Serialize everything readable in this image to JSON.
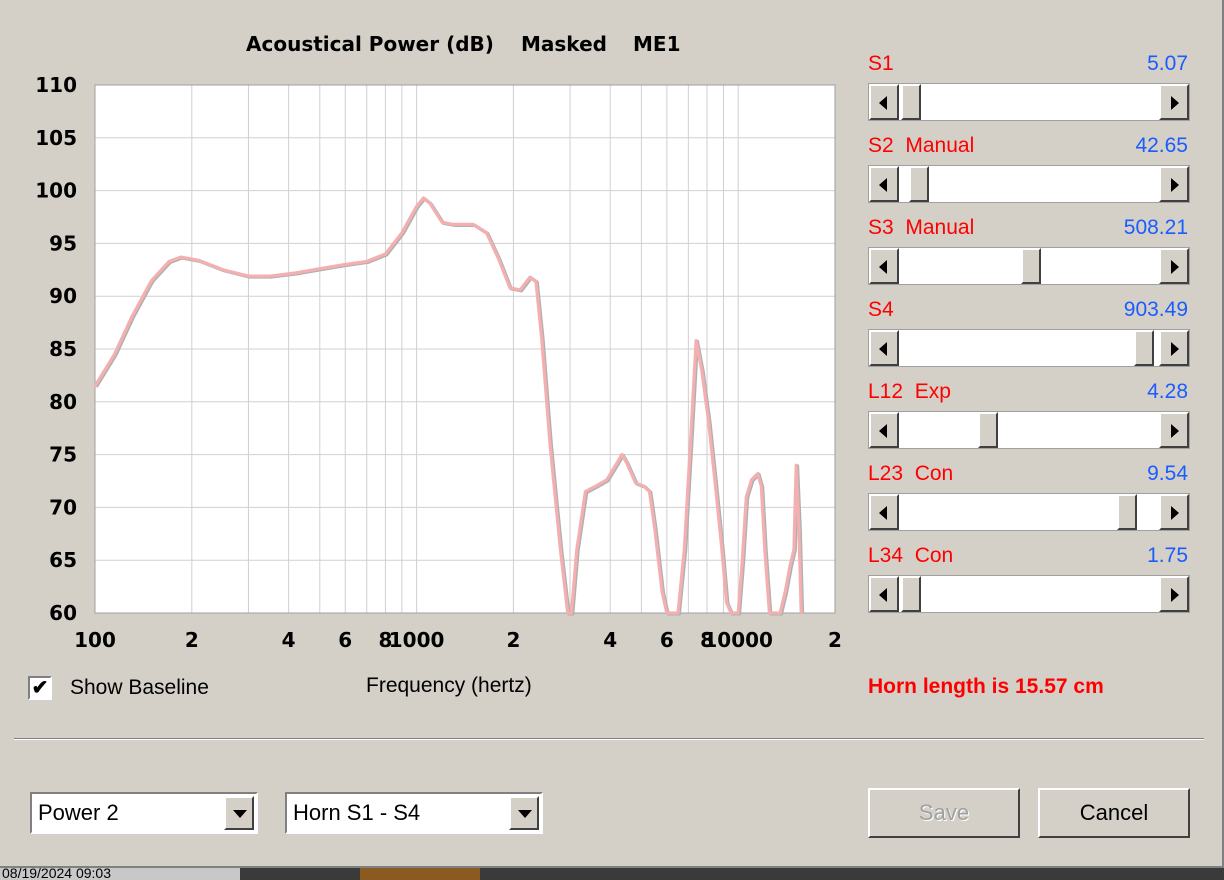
{
  "chart_data": {
    "type": "line",
    "title_parts": [
      "Acoustical Power (dB)",
      "Masked",
      "ME1"
    ],
    "xlabel": "Frequency (hertz)",
    "ylabel": "",
    "xscale": "log",
    "xlim": [
      100,
      20000
    ],
    "ylim": [
      60,
      110
    ],
    "yticks": [
      110,
      105,
      100,
      95,
      90,
      85,
      80,
      75,
      70,
      65,
      60
    ],
    "xticks": [
      {
        "v": 100,
        "label": "100"
      },
      {
        "v": 200,
        "label": "2"
      },
      {
        "v": 400,
        "label": "4"
      },
      {
        "v": 600,
        "label": "6"
      },
      {
        "v": 800,
        "label": "8"
      },
      {
        "v": 1000,
        "label": "1000"
      },
      {
        "v": 2000,
        "label": "2"
      },
      {
        "v": 4000,
        "label": "4"
      },
      {
        "v": 6000,
        "label": "6"
      },
      {
        "v": 8000,
        "label": "8"
      },
      {
        "v": 10000,
        "label": "10000"
      },
      {
        "v": 20000,
        "label": "2"
      }
    ],
    "grid": true,
    "series_color": "#f4b0b0",
    "baseline_color": "#b0b0b0",
    "series": [
      {
        "name": "",
        "points": [
          [
            100,
            81.5
          ],
          [
            115,
            84.5
          ],
          [
            130,
            88
          ],
          [
            150,
            91.5
          ],
          [
            170,
            93.3
          ],
          [
            185,
            93.7
          ],
          [
            210,
            93.4
          ],
          [
            250,
            92.5
          ],
          [
            300,
            91.9
          ],
          [
            350,
            91.9
          ],
          [
            420,
            92.2
          ],
          [
            500,
            92.6
          ],
          [
            600,
            93
          ],
          [
            700,
            93.3
          ],
          [
            800,
            94
          ],
          [
            900,
            96
          ],
          [
            1000,
            98.5
          ],
          [
            1050,
            99.3
          ],
          [
            1100,
            98.8
          ],
          [
            1200,
            97
          ],
          [
            1300,
            96.8
          ],
          [
            1500,
            96.8
          ],
          [
            1650,
            96
          ],
          [
            1800,
            93.5
          ],
          [
            1950,
            90.8
          ],
          [
            2100,
            90.6
          ],
          [
            2250,
            91.8
          ],
          [
            2350,
            91.4
          ],
          [
            2450,
            86
          ],
          [
            2600,
            76
          ],
          [
            2800,
            66
          ],
          [
            2950,
            60
          ],
          [
            3030,
            60
          ],
          [
            3150,
            66
          ],
          [
            3350,
            71.5
          ],
          [
            3600,
            72
          ],
          [
            3900,
            72.6
          ],
          [
            4200,
            74.2
          ],
          [
            4350,
            75
          ],
          [
            4500,
            74.2
          ],
          [
            4800,
            72.3
          ],
          [
            5100,
            72
          ],
          [
            5300,
            71.5
          ],
          [
            5500,
            68
          ],
          [
            5800,
            62
          ],
          [
            6000,
            60
          ],
          [
            6500,
            60
          ],
          [
            6800,
            66
          ],
          [
            7100,
            76
          ],
          [
            7400,
            85.8
          ],
          [
            7700,
            83
          ],
          [
            8100,
            78
          ],
          [
            8500,
            72
          ],
          [
            8900,
            66
          ],
          [
            9200,
            61
          ],
          [
            9500,
            60
          ],
          [
            10000,
            60
          ],
          [
            10300,
            65
          ],
          [
            10600,
            71
          ],
          [
            11000,
            72.6
          ],
          [
            11500,
            73.2
          ],
          [
            11800,
            72
          ],
          [
            12100,
            66
          ],
          [
            12500,
            60
          ],
          [
            13500,
            60
          ],
          [
            14000,
            62
          ],
          [
            14500,
            64.5
          ],
          [
            14900,
            66
          ],
          [
            15150,
            74
          ],
          [
            15450,
            68
          ],
          [
            15700,
            60
          ]
        ]
      }
    ]
  },
  "sliders": [
    {
      "label": "S1",
      "value": "5.07",
      "level": 0.01
    },
    {
      "label": "S2  Manual",
      "value": "42.65",
      "level": 0.04
    },
    {
      "label": "S3  Manual",
      "value": "508.21",
      "level": 0.51
    },
    {
      "label": "S4",
      "value": "903.49",
      "level": 0.98
    },
    {
      "label": "L12  Exp",
      "value": "4.28",
      "level": 0.33
    },
    {
      "label": "L23  Con",
      "value": "9.54",
      "level": 0.91
    },
    {
      "label": "L34  Con",
      "value": "1.75",
      "level": 0.01
    }
  ],
  "show_baseline": {
    "label": "Show Baseline",
    "checked": true,
    "check_glyph": "✔"
  },
  "horn_length": "Horn length is 15.57 cm",
  "combo_left": "Power 2",
  "combo_right": "Horn S1 - S4",
  "save_label": "Save",
  "cancel_label": "Cancel",
  "taskbar_text": "08/19/2024  09:03"
}
